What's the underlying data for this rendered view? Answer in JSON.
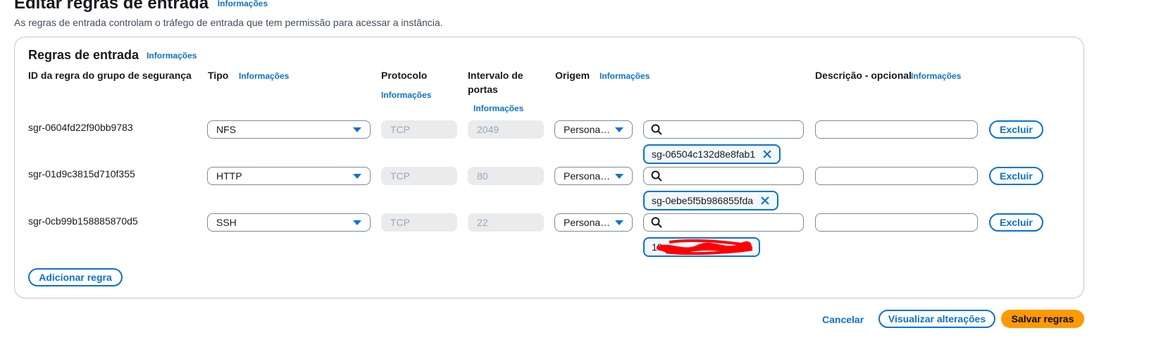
{
  "page": {
    "title": "Editar regras de entrada",
    "title_info": "Informações",
    "description": "As regras de entrada controlam o tráfego de entrada que tem permissão para acessar a instância."
  },
  "panel": {
    "title": "Regras de entrada",
    "title_info": "Informações",
    "columns": {
      "rule_id": "ID da regra do grupo de segurança",
      "type": "Tipo",
      "type_info": "Informações",
      "protocol": "Protocolo",
      "protocol_info": "Informações",
      "port_range_line1": "Intervalo de",
      "port_range_line2": "portas",
      "port_range_info": "Informações",
      "source": "Origem",
      "source_info": "Informações",
      "description": "Descrição - opcional",
      "description_info": "Informações"
    },
    "rules": [
      {
        "id": "sgr-0604fd22f90bb9783",
        "type": "NFS",
        "protocol": "TCP",
        "port_range": "2049",
        "source_type": "Persona…",
        "source_search": "",
        "source_token": "sg-06504c132d8e8fab1",
        "description": "",
        "delete_label": "Excluir"
      },
      {
        "id": "sgr-01d9c3815d710f355",
        "type": "HTTP",
        "protocol": "TCP",
        "port_range": "80",
        "source_type": "Persona…",
        "source_search": "",
        "source_token": "sg-0ebe5f5b986855fda",
        "description": "",
        "delete_label": "Excluir"
      },
      {
        "id": "sgr-0cb99b158885870d5",
        "type": "SSH",
        "protocol": "TCP",
        "port_range": "22",
        "source_type": "Persona…",
        "source_search": "",
        "source_token": "18",
        "description": "",
        "delete_label": "Excluir"
      }
    ],
    "add_rule_label": "Adicionar regra"
  },
  "footer": {
    "cancel_label": "Cancelar",
    "preview_label": "Visualizar alterações",
    "save_label": "Salvar regras"
  },
  "colors": {
    "accent": "#0972d3",
    "primary_button": "#ff9900",
    "redaction": "#ff0000"
  },
  "icons": {
    "caret": "caret-down-icon",
    "search": "search-icon",
    "remove": "close-icon"
  }
}
